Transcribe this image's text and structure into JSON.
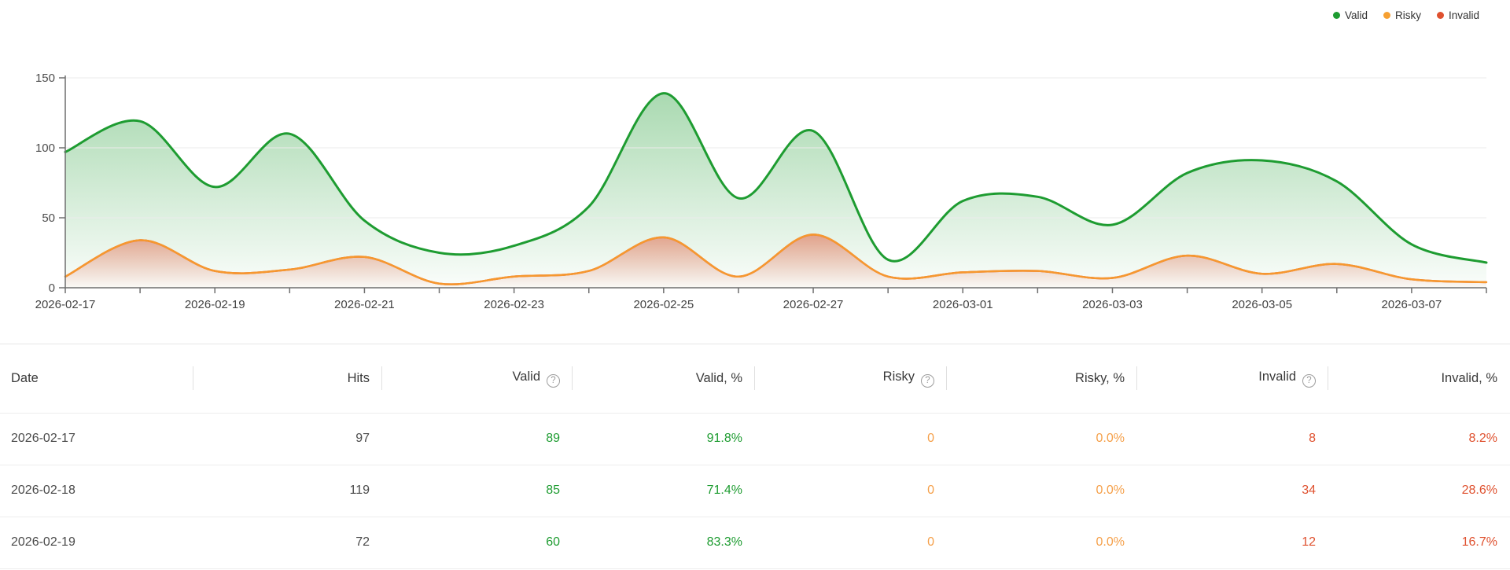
{
  "colors": {
    "valid": "#1E9C31",
    "risky": "#F6A032",
    "risky_line": "#F6982F",
    "risky_text": "#F5A04A",
    "invalid": "#DF512F",
    "axis": "#6f6f6f",
    "gridline": "#ebebeb"
  },
  "legend": {
    "items": [
      {
        "label": "Valid",
        "color": "#1E9C31"
      },
      {
        "label": "Risky",
        "color": "#F6A032"
      },
      {
        "label": "Invalid",
        "color": "#DF512F"
      }
    ]
  },
  "chart_data": {
    "type": "area",
    "stacked": true,
    "title": "",
    "xlabel": "",
    "ylabel": "",
    "ylim": [
      0,
      150
    ],
    "yticks": [
      0,
      50,
      100,
      150
    ],
    "grid": true,
    "legend_position": "top-right",
    "x": [
      "2026-02-17",
      "2026-02-18",
      "2026-02-19",
      "2026-02-20",
      "2026-02-21",
      "2026-02-22",
      "2026-02-23",
      "2026-02-24",
      "2026-02-25",
      "2026-02-26",
      "2026-02-27",
      "2026-02-28",
      "2026-03-01",
      "2026-03-02",
      "2026-03-03",
      "2026-03-04",
      "2026-03-05",
      "2026-03-06",
      "2026-03-07",
      "2026-03-08"
    ],
    "x_tick_labels": [
      "2026-02-17",
      "2026-02-19",
      "2026-02-21",
      "2026-02-23",
      "2026-02-25",
      "2026-02-27",
      "2026-03-01",
      "2026-03-03",
      "2026-03-05",
      "2026-03-07"
    ],
    "series": [
      {
        "name": "Invalid",
        "values": [
          8,
          34,
          12,
          13,
          22,
          3,
          8,
          12,
          36,
          8,
          38,
          8,
          11,
          12,
          7,
          23,
          10,
          17,
          6,
          4
        ]
      },
      {
        "name": "Risky",
        "values": [
          0,
          0,
          0,
          0,
          0,
          0,
          0,
          0,
          0,
          0,
          0,
          0,
          0,
          0,
          0,
          0,
          0,
          0,
          0,
          0
        ]
      },
      {
        "name": "Valid",
        "values": [
          89,
          85,
          60,
          97,
          26,
          22,
          22,
          46,
          103,
          56,
          74,
          12,
          51,
          53,
          38,
          59,
          81,
          59,
          25,
          14
        ]
      }
    ],
    "stacked_totals": [
      97,
      119,
      72,
      110,
      48,
      25,
      30,
      58,
      139,
      64,
      112,
      20,
      62,
      65,
      45,
      82,
      91,
      76,
      31,
      18
    ]
  },
  "table": {
    "columns": [
      {
        "label": "Date",
        "has_help": false
      },
      {
        "label": "Hits",
        "has_help": false
      },
      {
        "label": "Valid",
        "has_help": true
      },
      {
        "label": "Valid, %",
        "has_help": false
      },
      {
        "label": "Risky",
        "has_help": true
      },
      {
        "label": "Risky, %",
        "has_help": false
      },
      {
        "label": "Invalid",
        "has_help": true
      },
      {
        "label": "Invalid, %",
        "has_help": false
      }
    ],
    "help_glyph": "?",
    "rows": [
      {
        "date": "2026-02-17",
        "hits": "97",
        "valid": "89",
        "valid_pct": "91.8%",
        "risky": "0",
        "risky_pct": "0.0%",
        "invalid": "8",
        "invalid_pct": "8.2%"
      },
      {
        "date": "2026-02-18",
        "hits": "119",
        "valid": "85",
        "valid_pct": "71.4%",
        "risky": "0",
        "risky_pct": "0.0%",
        "invalid": "34",
        "invalid_pct": "28.6%"
      },
      {
        "date": "2026-02-19",
        "hits": "72",
        "valid": "60",
        "valid_pct": "83.3%",
        "risky": "0",
        "risky_pct": "0.0%",
        "invalid": "12",
        "invalid_pct": "16.7%"
      }
    ]
  }
}
